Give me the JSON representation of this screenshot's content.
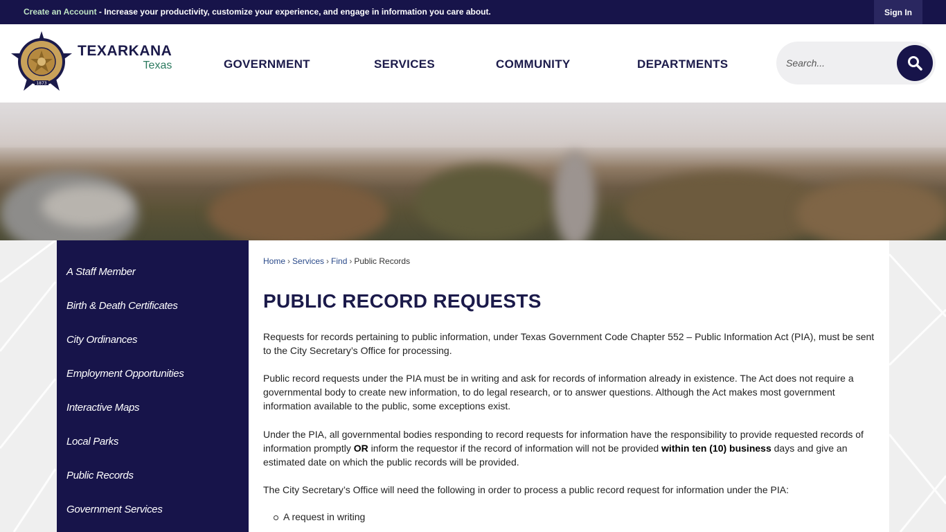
{
  "topbar": {
    "create_account": "Create an Account",
    "message": " - Increase your productivity, customize your experience, and engage in information you care about.",
    "sign_in": "Sign In"
  },
  "header": {
    "logo_name": "TEXARKANA",
    "logo_state": "Texas",
    "seal_text": "CITY OF TEXARKANA",
    "seal_year": "1873",
    "nav": [
      "GOVERNMENT",
      "SERVICES",
      "COMMUNITY",
      "DEPARTMENTS"
    ],
    "search_placeholder": "Search..."
  },
  "sidebar": {
    "items": [
      "A Staff Member",
      "Birth & Death Certificates",
      "City Ordinances",
      "Employment Opportunities",
      "Interactive Maps",
      "Local Parks",
      "Public Records",
      "Government Services"
    ]
  },
  "main": {
    "breadcrumb": [
      "Home",
      "Services",
      "Find",
      "Public Records"
    ],
    "title": "PUBLIC RECORD REQUESTS",
    "para1": "Requests for records pertaining to public information, under Texas Government Code Chapter 552 – Public Information Act (PIA), must be sent to the City Secretary’s Office for processing.",
    "para2": "Public record requests under the PIA must be in writing and ask for records of information already in existence. The Act does not require a governmental body to create new information, to do legal research, or to answer questions. Although the Act makes most government information available to the public, some exceptions exist.",
    "para3_a": "Under the PIA, all governmental bodies responding to record requests for information have the responsibility to provide requested records of information promptly ",
    "para3_or": "OR",
    "para3_b": " inform the requestor if the record of information will not be provided ",
    "para3_bold": "within ten (10) business",
    "para3_c": " days and give an estimated date on which the public records will be provided.",
    "para4": "The City Secretary’s Office will need the following in order to process a public record request for information under the PIA:",
    "bullets": [
      "A request in writing"
    ]
  },
  "colors": {
    "navy": "#17144a",
    "green": "#2c7a5f",
    "white": "#ffffff"
  }
}
